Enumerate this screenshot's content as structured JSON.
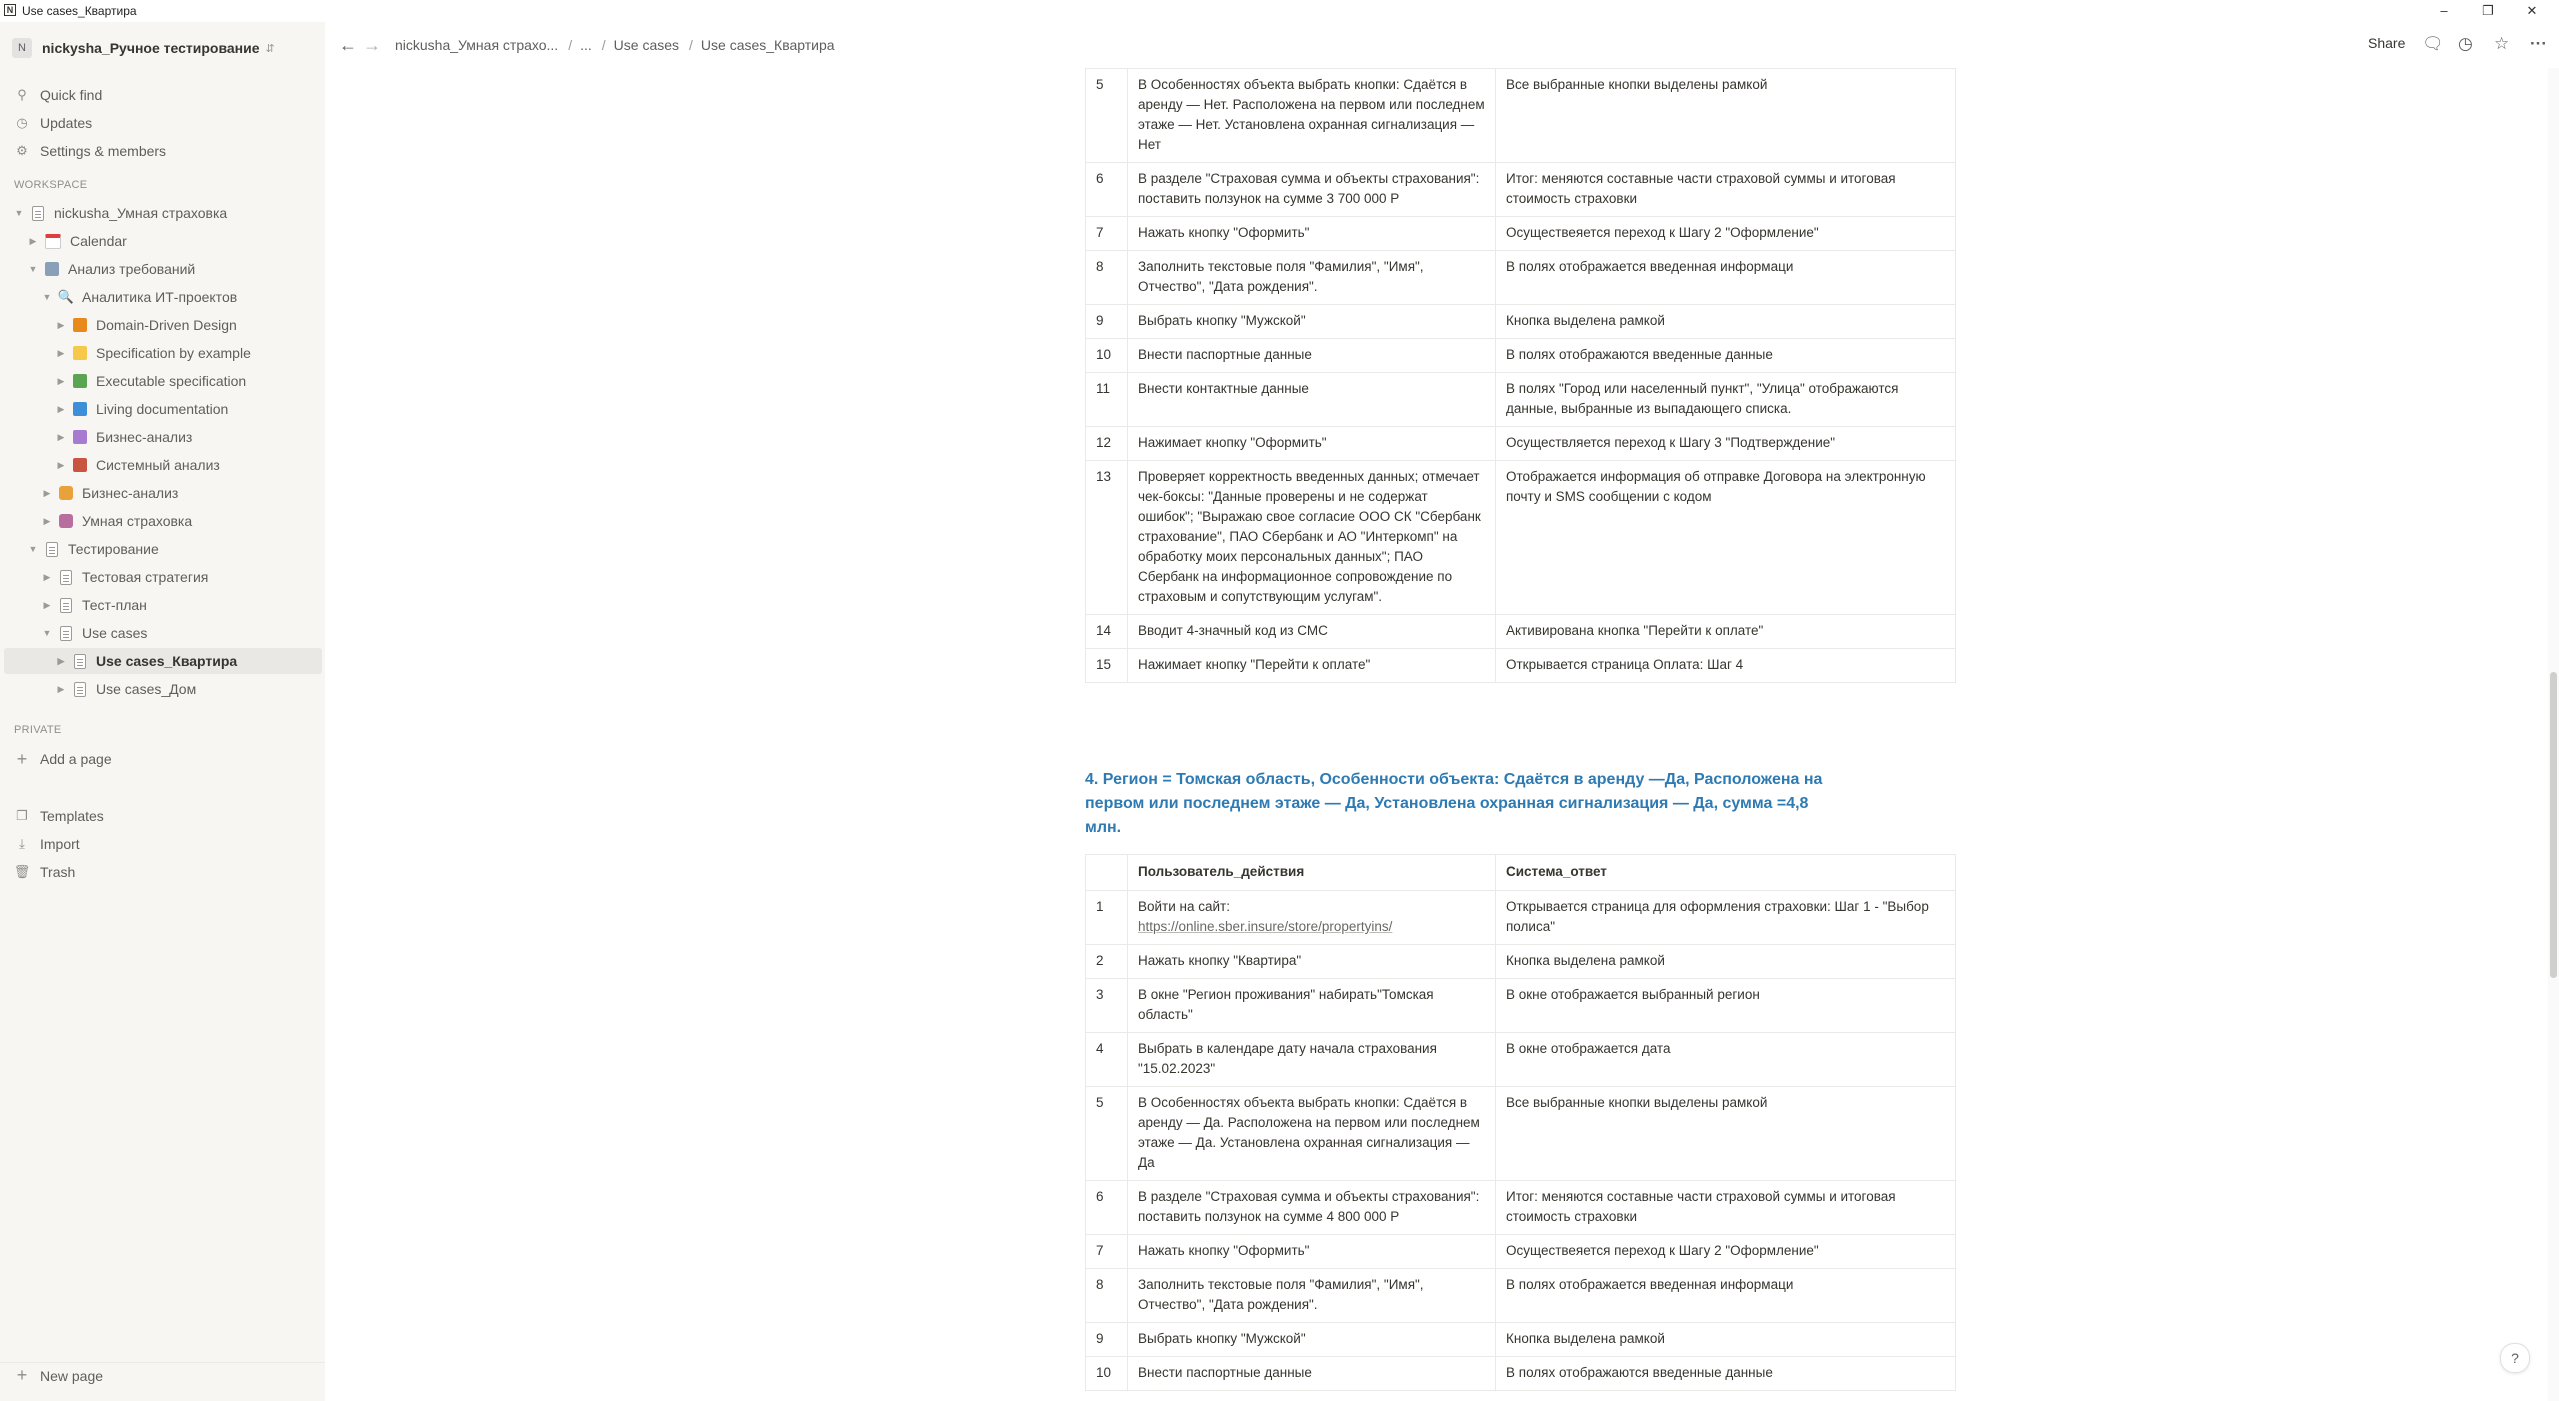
{
  "window": {
    "title": "Use cases_Квартира"
  },
  "sidebar": {
    "workspace_avatar": "N",
    "workspace_name": "nickysha_Ручное тестирование",
    "quick_find": "Quick find",
    "updates": "Updates",
    "settings": "Settings & members",
    "workspace_header": "WORKSPACE",
    "private_header": "PRIVATE",
    "add_page": "Add a page",
    "templates": "Templates",
    "import": "Import",
    "trash": "Trash",
    "new_page": "New page",
    "tree": [
      {
        "label": "nickusha_Умная страховка"
      },
      {
        "label": "Calendar"
      },
      {
        "label": "Анализ требований"
      },
      {
        "label": "Аналитика ИТ-проектов"
      },
      {
        "label": "Domain-Driven Design",
        "color": "#e8891c"
      },
      {
        "label": "Specification by example",
        "color": "#f6c94b"
      },
      {
        "label": "Executable specification",
        "color": "#5ba552"
      },
      {
        "label": "Living documentation",
        "color": "#3f8fd8"
      },
      {
        "label": "Бизнес-анализ",
        "color": "#a77bd0"
      },
      {
        "label": "Системный анализ",
        "color": "#c8553f"
      },
      {
        "label": "Бизнес-анализ"
      },
      {
        "label": "Умная страховка"
      },
      {
        "label": "Тестирование"
      },
      {
        "label": "Тестовая стратегия"
      },
      {
        "label": "Тест-план"
      },
      {
        "label": "Use cases"
      },
      {
        "label": "Use cases_Квартира"
      },
      {
        "label": "Use cases_Дом"
      }
    ]
  },
  "topbar": {
    "crumbs": [
      "nickusha_Умная страхо...",
      "...",
      "Use cases",
      "Use cases_Квартира"
    ],
    "share": "Share"
  },
  "table1": {
    "rows": [
      {
        "n": "5",
        "action": "В Особенностях объекта выбрать кнопки: Сдаётся в аренду — Нет. Расположена на первом или последнем этаже — Нет. Установлена охранная сигнализация — Нет",
        "result": "Все выбранные кнопки выделены рамкой"
      },
      {
        "n": "6",
        "action": "В разделе \"Страховая сумма и объекты страхования\": поставить ползунок на сумме 3 700 000 Р",
        "result": "Итог: меняются составные части страховой суммы и итоговая стоимость страховки"
      },
      {
        "n": "7",
        "action": "Нажать кнопку \"Оформить\"",
        "result": "Осуществеяется переход  к Шагу 2 \"Оформление\""
      },
      {
        "n": "8",
        "action": "Заполнить текстовые поля \"Фамилия\", \"Имя\", Отчество\", \"Дата рождения\".",
        "result": "В полях отображается введенная информаци"
      },
      {
        "n": "9",
        "action": "Выбрать кнопку \"Мужской\"",
        "result": "Кнопка выделена рамкой"
      },
      {
        "n": "10",
        "action": "Внести паспортные данные",
        "result": "В полях отображаются введенные данные"
      },
      {
        "n": "11",
        "action": "Внести контактные данные",
        "result": "В полях \"Город или населенный пункт\", \"Улица\" отображаются данные, выбранные из выпадающего списка."
      },
      {
        "n": "12",
        "action": "Нажимает кнопку \"Оформить\"",
        "result": "Осуществляется переход к Шагу 3 \"Подтверждение\""
      },
      {
        "n": "13",
        "action": "Проверяет корректность введенных данных; отмечает чек-боксы: \"Данные проверены и не содержат ошибок\"; \"Выражаю свое согласие ООО СК \"Сбербанк страхование\", ПАО Сбербанк и АО \"Интеркомп\" на обработку моих персональных данных\"; ПАО Сбербанк на информационное сопровождение по страховым и сопутствующим услугам\".",
        "result": "Отображается информация об отправке Договора на электронную почту и SMS сообщении с кодом"
      },
      {
        "n": "14",
        "action": "Вводит 4-значный код из СМС",
        "result": "Активирована кнопка \"Перейти к оплате\""
      },
      {
        "n": "15",
        "action": "Нажимает кнопку \"Перейти к оплате\"",
        "result": "Открывается страница Оплата: Шаг 4"
      }
    ]
  },
  "section4": {
    "title": "4. Регион = Томская область, Особенности объекта: Сдаётся в аренду —Да, Расположена на первом или последнем этаже — Да, Установлена охранная сигнализация — Да, сумма =4,8 млн."
  },
  "table2": {
    "headers": [
      "",
      "Пользователь_действия",
      "Система_ответ"
    ],
    "rows": [
      {
        "n": "1",
        "action": "Войти на сайт:",
        "link": "https://online.sber.insure/store/propertyins/",
        "result": "Открывается страница для оформления страховки: Шаг 1 - \"Выбор полиса\""
      },
      {
        "n": "2",
        "action": "Нажать кнопку \"Квартира\"",
        "result": "Кнопка выделена рамкой"
      },
      {
        "n": "3",
        "action": "В окне \"Регион проживания\" набирать\"Томская область\"",
        "result": "В окне отображается выбранный регион"
      },
      {
        "n": "4",
        "action": "Выбрать в календаре дату начала страхования \"15.02.2023\"",
        "result": "В окне отображается дата"
      },
      {
        "n": "5",
        "action": "В Особенностях объекта выбрать кнопки: Сдаётся в аренду — Да. Расположена на первом или последнем этаже — Да. Установлена охранная сигнализация — Да",
        "result": "Все выбранные кнопки выделены рамкой"
      },
      {
        "n": "6",
        "action": "В разделе \"Страховая сумма и объекты страхования\": поставить ползунок на сумме 4 800 000 Р",
        "result": "Итог: меняются составные части страховой суммы и итоговая стоимость страховки"
      },
      {
        "n": "7",
        "action": "Нажать кнопку \"Оформить\"",
        "result": "Осуществеяется переход  к Шагу 2 \"Оформление\""
      },
      {
        "n": "8",
        "action": "Заполнить текстовые поля \"Фамилия\", \"Имя\", Отчество\", \"Дата рождения\".",
        "result": "В полях отображается введенная информаци"
      },
      {
        "n": "9",
        "action": "Выбрать кнопку \"Мужской\"",
        "result": "Кнопка выделена рамкой"
      },
      {
        "n": "10",
        "action": "Внести паспортные данные",
        "result": "В полях отображаются введенные данные"
      }
    ]
  },
  "help": "?"
}
